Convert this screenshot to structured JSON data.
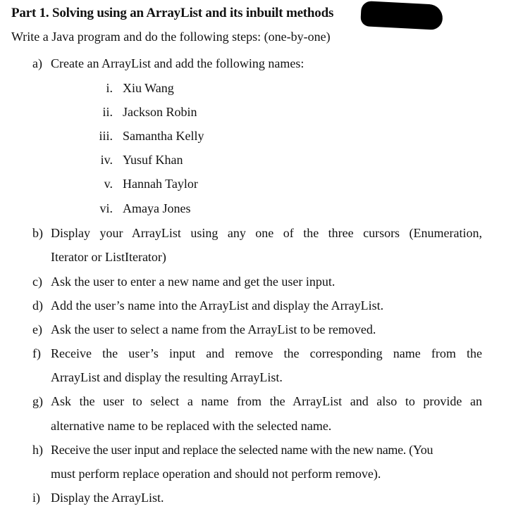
{
  "document": {
    "title": "Part 1. Solving using an ArrayList and its inbuilt methods",
    "intro": "Write a Java program and do the following steps: (one-by-one)",
    "steps": [
      {
        "label": "a)",
        "lines": [
          "Create an ArrayList and add the following names:"
        ],
        "sub_items": [
          {
            "label": "i.",
            "text": "Xiu Wang"
          },
          {
            "label": "ii.",
            "text": "Jackson Robin"
          },
          {
            "label": "iii.",
            "text": "Samantha Kelly"
          },
          {
            "label": "iv.",
            "text": "Yusuf Khan"
          },
          {
            "label": "v.",
            "text": "Hannah Taylor"
          },
          {
            "label": "vi.",
            "text": "Amaya Jones"
          }
        ]
      },
      {
        "label": "b)",
        "lines": [
          "Display your ArrayList using any one of the three cursors (Enumeration,",
          "Iterator or ListIterator)"
        ]
      },
      {
        "label": "c)",
        "lines": [
          "Ask the user to enter a new name and get the user input."
        ]
      },
      {
        "label": "d)",
        "lines": [
          "Add the user’s name into the ArrayList and display the ArrayList."
        ]
      },
      {
        "label": "e)",
        "lines": [
          "Ask the user to select a name from the ArrayList to be removed."
        ]
      },
      {
        "label": "f)",
        "lines": [
          "Receive the user’s input and remove the corresponding name from the",
          "ArrayList and display the resulting ArrayList."
        ]
      },
      {
        "label": "g)",
        "lines": [
          "Ask the user to select a name from the ArrayList and also to provide an",
          "alternative name to be replaced with the selected name."
        ]
      },
      {
        "label": "h)",
        "lines": [
          "Receive the user input and replace the selected name with the new name. (You",
          "must perform replace operation and should not perform remove)."
        ]
      },
      {
        "label": "i)",
        "lines": [
          "Display the ArrayList."
        ]
      }
    ]
  }
}
